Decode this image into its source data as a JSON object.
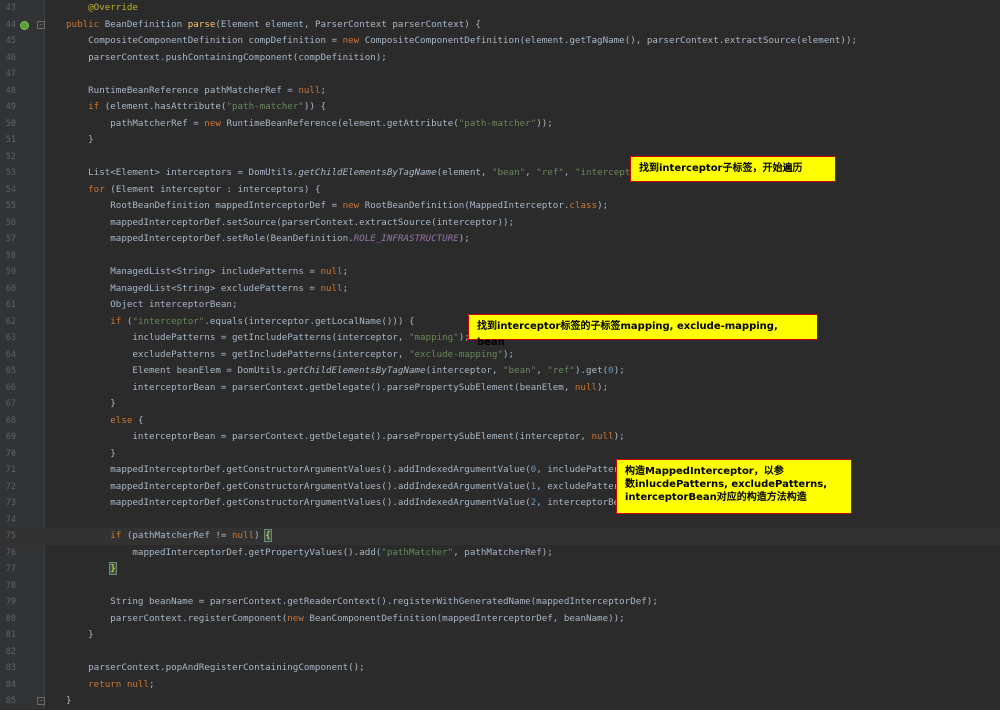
{
  "editor": {
    "lines": [
      {
        "n": "43",
        "html": "    <span class='a'>@Override</span>"
      },
      {
        "n": "44",
        "html": "<span class='k'>public</span> BeanDefinition <span class='f'>parse</span>(Element element, ParserContext parserContext) {",
        "marker": true,
        "fold": "−"
      },
      {
        "n": "45",
        "html": "    CompositeComponentDefinition compDefinition = <span class='k'>new</span> CompositeComponentDefinition(element.getTagName(), parserContext.extractSource(element));"
      },
      {
        "n": "46",
        "html": "    parserContext.pushContainingComponent(compDefinition);"
      },
      {
        "n": "47",
        "html": ""
      },
      {
        "n": "48",
        "html": "    RuntimeBeanReference pathMatcherRef = <span class='k'>null</span>;"
      },
      {
        "n": "49",
        "html": "    <span class='k'>if</span> (element.hasAttribute(<span class='s'>\"path-matcher\"</span>)) {"
      },
      {
        "n": "50",
        "html": "        pathMatcherRef = <span class='k'>new</span> RuntimeBeanReference(element.getAttribute(<span class='s'>\"path-matcher\"</span>));"
      },
      {
        "n": "51",
        "html": "    }"
      },
      {
        "n": "52",
        "html": ""
      },
      {
        "n": "53",
        "html": "    List&lt;Element&gt; interceptors = DomUtils.<span class='i'>getChildElementsByTagName</span>(element, <span class='s'>\"bean\"</span>, <span class='s'>\"ref\"</span>, <span class='s'>\"interceptor\"</span>);"
      },
      {
        "n": "54",
        "html": "    <span class='k'>for</span> (Element interceptor : interceptors) {"
      },
      {
        "n": "55",
        "html": "        RootBeanDefinition mappedInterceptorDef = <span class='k'>new</span> RootBeanDefinition(MappedInterceptor.<span class='k'>class</span>);"
      },
      {
        "n": "56",
        "html": "        mappedInterceptorDef.setSource(parserContext.extractSource(interceptor));"
      },
      {
        "n": "57",
        "html": "        mappedInterceptorDef.setRole(BeanDefinition.<span class='c'>ROLE_INFRASTRUCTURE</span>);"
      },
      {
        "n": "58",
        "html": ""
      },
      {
        "n": "59",
        "html": "        ManagedList&lt;String&gt; includePatterns = <span class='k'>null</span>;"
      },
      {
        "n": "60",
        "html": "        ManagedList&lt;String&gt; excludePatterns = <span class='k'>null</span>;"
      },
      {
        "n": "61",
        "html": "        Object interceptorBean;"
      },
      {
        "n": "62",
        "html": "        <span class='k'>if</span> (<span class='s'>\"interceptor\"</span>.equals(interceptor.getLocalName())) {"
      },
      {
        "n": "63",
        "html": "            includePatterns = getIncludePatterns(interceptor, <span class='s'>\"mapping\"</span>);"
      },
      {
        "n": "64",
        "html": "            excludePatterns = getIncludePatterns(interceptor, <span class='s'>\"exclude-mapping\"</span>);"
      },
      {
        "n": "65",
        "html": "            Element beanElem = DomUtils.<span class='i'>getChildElementsByTagName</span>(interceptor, <span class='s'>\"bean\"</span>, <span class='s'>\"ref\"</span>).get(<span class='num'>0</span>);"
      },
      {
        "n": "66",
        "html": "            interceptorBean = parserContext.getDelegate().parsePropertySubElement(beanElem, <span class='k'>null</span>);"
      },
      {
        "n": "67",
        "html": "        }"
      },
      {
        "n": "68",
        "html": "        <span class='k'>else</span> {"
      },
      {
        "n": "69",
        "html": "            interceptorBean = parserContext.getDelegate().parsePropertySubElement(interceptor, <span class='k'>null</span>);"
      },
      {
        "n": "70",
        "html": "        }"
      },
      {
        "n": "71",
        "html": "        mappedInterceptorDef.getConstructorArgumentValues().addIndexedArgumentValue(<span class='num'>0</span>, includePatterns);"
      },
      {
        "n": "72",
        "html": "        mappedInterceptorDef.getConstructorArgumentValues().addIndexedArgumentValue(<span class='num'>1</span>, excludePatterns);"
      },
      {
        "n": "73",
        "html": "        mappedInterceptorDef.getConstructorArgumentValues().addIndexedArgumentValue(<span class='num'>2</span>, interceptorBean);"
      },
      {
        "n": "74",
        "html": ""
      },
      {
        "n": "75",
        "html": "        <span class='k'>if</span> (pathMatcherRef != <span class='k'>null</span>) <span class='brace'>{</span>",
        "current": true
      },
      {
        "n": "76",
        "html": "            mappedInterceptorDef.getPropertyValues().add(<span class='s'>\"pathMatcher\"</span>, pathMatcherRef);"
      },
      {
        "n": "77",
        "html": "        <span class='brace'>}</span>"
      },
      {
        "n": "78",
        "html": ""
      },
      {
        "n": "79",
        "html": "        String beanName = parserContext.getReaderContext().registerWithGeneratedName(mappedInterceptorDef);"
      },
      {
        "n": "80",
        "html": "        parserContext.registerComponent(<span class='k'>new</span> BeanComponentDefinition(mappedInterceptorDef, beanName));"
      },
      {
        "n": "81",
        "html": "    }"
      },
      {
        "n": "82",
        "html": ""
      },
      {
        "n": "83",
        "html": "    parserContext.popAndRegisterContainingComponent();"
      },
      {
        "n": "84",
        "html": "    <span class='k'>return null</span>;"
      },
      {
        "n": "85",
        "html": "}",
        "fold": "−"
      }
    ]
  },
  "callouts": {
    "c1": "找到interceptor子标签，开始遍历",
    "c2": "找到interceptor标签的子标签mapping, exclude-mapping, bean",
    "c3_line1": "构造MappedInterceptor，以参",
    "c3_line2": "数inlucdePatterns, excludePatterns,",
    "c3_line3": "interceptorBean对应的构造方法构造"
  },
  "colors": {
    "background": "#2b2b2b",
    "keyword": "#cc7832",
    "string": "#6a8759",
    "annotation": "#bbb529",
    "callout_bg": "#ffff00",
    "callout_border": "#d20000"
  }
}
